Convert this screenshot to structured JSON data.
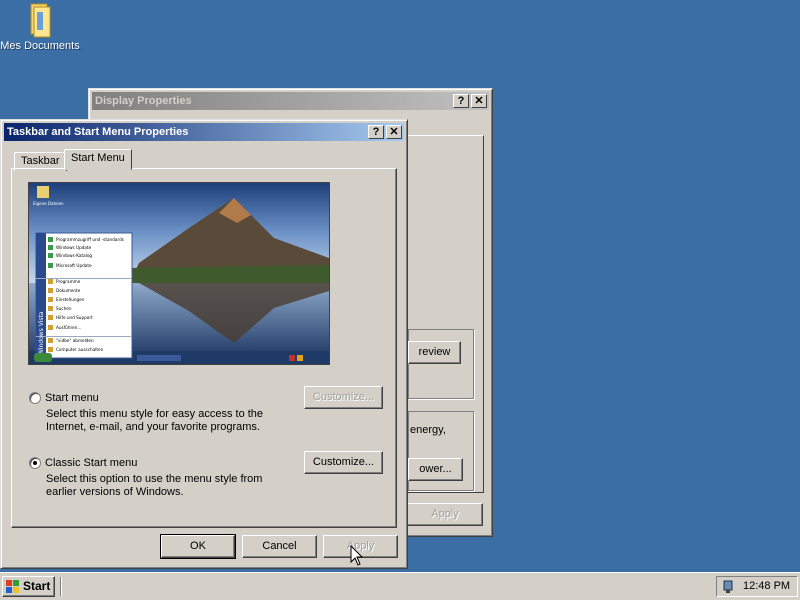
{
  "desktop": {
    "icon_label": "Mes Documents"
  },
  "display_window": {
    "title": "Display Properties",
    "help_btn": "?",
    "close_btn": "✕",
    "fragment_preview": "review",
    "fragment_energy": "energy,",
    "fragment_power": "ower...",
    "apply_label": "Apply"
  },
  "dialog": {
    "title": "Taskbar and Start Menu Properties",
    "help_btn": "?",
    "close_btn": "✕",
    "tabs": [
      "Taskbar",
      "Start Menu"
    ],
    "preview": {
      "menu_items": [
        "Programmzugriff und -standards",
        "Windows Update",
        "Windows-Katalog",
        "Microsoft Update",
        "Programme",
        "Dokumente",
        "Einstellungen",
        "Suchen",
        "Hilfe und Support",
        "Ausführen...",
        "\"vidbe\" abmelden",
        "Computer ausschalten"
      ],
      "side_text": "Windows Vista",
      "desktop_icon": "Eigene Dateien"
    },
    "options": [
      {
        "label": "Start menu",
        "desc": "Select this menu style for easy access to the Internet, e-mail, and your favorite programs.",
        "button": "Customize...",
        "selected": false,
        "button_enabled": false
      },
      {
        "label": "Classic Start menu",
        "desc": "Select this option to use the menu style from earlier versions of Windows.",
        "button": "Customize...",
        "selected": true,
        "button_enabled": true
      }
    ],
    "buttons": {
      "ok": "OK",
      "cancel": "Cancel",
      "apply": "Apply"
    }
  },
  "taskbar": {
    "start_label": "Start",
    "clock": "12:48 PM"
  }
}
